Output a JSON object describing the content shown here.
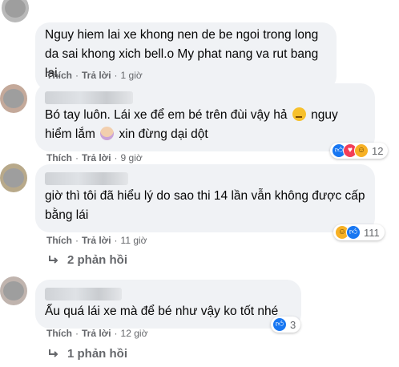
{
  "comments": [
    {
      "text": "Nguy hiem lai xe khong nen de be ngoi trong long da sai khong xich bell.o My phat nang va rut bang lai.",
      "actions": {
        "like": "Thích",
        "reply": "Trả lời",
        "time": "1 giờ"
      }
    },
    {
      "text_line1_a": "Bó tay luôn. Lái xe để em bé trên đùi vậy hả",
      "text_line1_b": "nguy",
      "text_line2_a": "hiểm lắm",
      "text_line2_b": "xin đừng dại dột",
      "emoji_1": "thinking-face",
      "emoji_2": "woman-gesturing",
      "actions": {
        "like": "Thích",
        "reply": "Trả lời",
        "time": "9 giờ"
      },
      "reactions": {
        "icons": [
          "like",
          "love",
          "haha"
        ],
        "count": "12"
      }
    },
    {
      "text": "giờ thì tôi đã hiểu lý do sao thi 14 lần vẫn không được cấp bằng lái",
      "actions": {
        "like": "Thích",
        "reply": "Trả lời",
        "time": "11 giờ"
      },
      "reactions": {
        "icons": [
          "haha",
          "like"
        ],
        "count": "111"
      },
      "replies": "2 phản hồi"
    },
    {
      "text": "Ấu quá lái xe mà để bé như vậy ko tốt nhé",
      "actions": {
        "like": "Thích",
        "reply": "Trả lời",
        "time": "12 giờ"
      },
      "reactions": {
        "icons": [
          "like"
        ],
        "count": "3"
      },
      "replies": "1 phản hồi"
    }
  ],
  "colors": {
    "bubble_bg": "#f0f2f5",
    "meta_text": "#65676b",
    "like_blue": "#1877f2",
    "love_red": "#f33e58",
    "haha_yellow": "#f7b125"
  }
}
